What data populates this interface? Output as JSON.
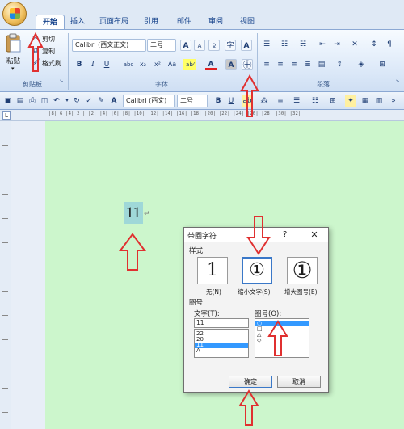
{
  "ribbon_tabs": [
    "开始",
    "插入",
    "页面布局",
    "引用",
    "邮件",
    "审阅",
    "视图"
  ],
  "clipboard": {
    "paste": "粘贴",
    "cut": "剪切",
    "copy": "复制",
    "format_painter": "格式刷",
    "group_label": "剪贴板"
  },
  "font": {
    "font_name": "Calibri (西文正文)",
    "font_size": "二号",
    "group_label": "字体",
    "grow_font": "A",
    "shrink_font": "A",
    "bold": "B",
    "italic": "I",
    "underline": "U",
    "strikethrough": "abc",
    "subscript": "x₂",
    "superscript": "x²",
    "change_case": "Aa",
    "highlight": "ab⁄",
    "font_color": "A",
    "char_shading": "A",
    "phonetic": "文",
    "char_border": "A",
    "enclose_char": "字"
  },
  "paragraph": {
    "group_label": "段落"
  },
  "quick_toolbar": {
    "font_name": "Calibri (西文)",
    "font_size": "二号"
  },
  "ruler": {
    "corner_mark": "L",
    "ticks": "|8| 6 |4| 2 | |2| |4| |6| |8| |10| |12| |14| |16| |18| |20| |22| |24| |26| |28| |30| |32|"
  },
  "document": {
    "selected_text": "11",
    "paragraph_mark": "↵"
  },
  "dialog": {
    "title": "带圈字符",
    "help": "?",
    "close": "✕",
    "style_label": "样式",
    "styles": [
      {
        "glyph": "1",
        "caption": "无(N)"
      },
      {
        "glyph": "①",
        "caption": "缩小文字(S)"
      },
      {
        "glyph": "①",
        "caption": "增大圈号(E)"
      }
    ],
    "circle_section_label": "圈号",
    "text_label": "文字(T):",
    "text_value": "11",
    "text_list": [
      "22",
      "20",
      "11",
      "A"
    ],
    "text_list_selected": "11",
    "circle_label": "圈号(O):",
    "circle_list": [
      "○",
      "□",
      "△",
      "◇"
    ],
    "circle_list_selected": "○",
    "ok": "确定",
    "cancel": "取消"
  },
  "colors": {
    "page_bg": "#ccf6cc",
    "selection": "#9fd8d8",
    "arrow_red": "#e03030",
    "list_highlight": "#3399ff"
  }
}
